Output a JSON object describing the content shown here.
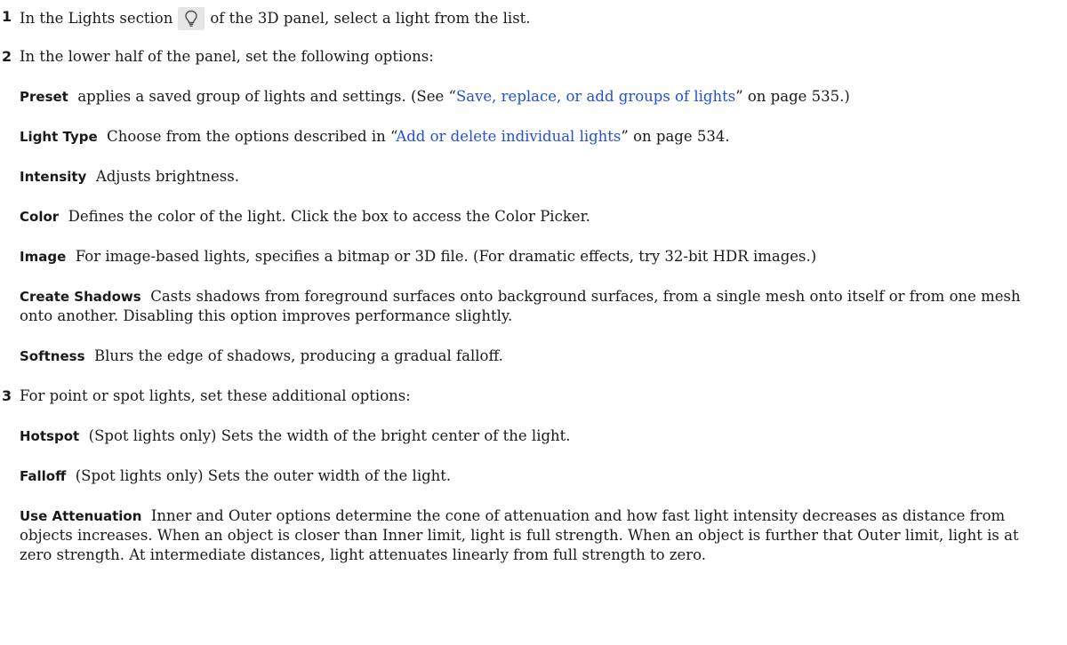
{
  "steps": [
    {
      "num": "1",
      "text_before": "In the Lights section",
      "icon": "light-bulb-icon",
      "text_after": "of the 3D panel, select a light from the list."
    },
    {
      "num": "2",
      "text": "In the lower half of the panel, set the following options:"
    },
    {
      "num": "3",
      "text": "For point or spot lights, set these additional options:"
    }
  ],
  "options_step2": [
    {
      "term": "Preset",
      "before": "applies a saved group of lights and settings. (See “",
      "link": "Save, replace, or add groups of lights",
      "after": "” on page 535.)"
    },
    {
      "term": "Light Type",
      "before": "Choose from the options described in “",
      "link": "Add or delete individual lights",
      "after": "” on page 534."
    },
    {
      "term": "Intensity",
      "text": "Adjusts brightness."
    },
    {
      "term": "Color",
      "text": "Defines the color of the light. Click the box to access the Color Picker."
    },
    {
      "term": "Image",
      "text": "For image-based lights, specifies a bitmap or 3D file. (For dramatic effects, try 32-bit HDR images.)"
    },
    {
      "term": "Create Shadows",
      "text": "Casts shadows from foreground surfaces onto background surfaces, from a single mesh onto itself or from one mesh onto another. Disabling this option improves performance slightly."
    },
    {
      "term": "Softness",
      "text": "Blurs the edge of shadows, producing a gradual falloff."
    }
  ],
  "options_step3": [
    {
      "term": "Hotspot",
      "text": "(Spot lights only) Sets the width of the bright center of the light."
    },
    {
      "term": "Falloff",
      "text": "(Spot lights only) Sets the outer width of the light."
    },
    {
      "term": "Use Attenuation",
      "text": "Inner and Outer options determine the cone of attenuation and how fast light intensity decreases as distance from objects increases. When an object is closer than Inner limit, light is full strength. When an object is further that Outer limit, light is at zero strength. At intermediate distances, light attenuates linearly from full strength to zero."
    }
  ],
  "colors": {
    "link": "#2350d6",
    "text": "#1a1a1a",
    "icon_bg": "#e6e6e6"
  }
}
